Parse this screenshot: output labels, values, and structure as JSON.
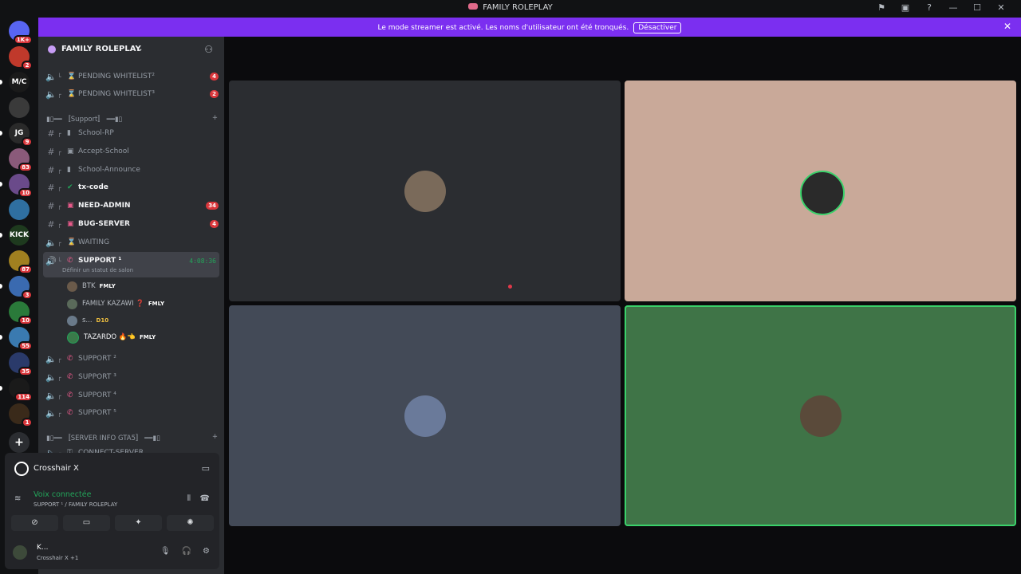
{
  "window": {
    "title": "FAMILY ROLEPLAY"
  },
  "banner": {
    "text": "Le mode streamer est activé. Les noms d'utilisateur ont été tronqués.",
    "button": "Désactiver"
  },
  "rail": [
    {
      "label": "",
      "badge": "1K+",
      "color": "#5865f2"
    },
    {
      "label": "",
      "badge": "2",
      "color": "#c0392b"
    },
    {
      "label": "M/C",
      "badge": "",
      "color": "#1a1a1a"
    },
    {
      "label": "",
      "badge": "",
      "color": "#3a3a3a"
    },
    {
      "label": "JG",
      "badge": "9",
      "color": "#2a2a2a"
    },
    {
      "label": "",
      "badge": "83",
      "color": "#8a5a7a"
    },
    {
      "label": "",
      "badge": "10",
      "color": "#6a4a8a"
    },
    {
      "label": "",
      "badge": "",
      "color": "#2f6fa0"
    },
    {
      "label": "KICK",
      "badge": "",
      "color": "#1e3a1e"
    },
    {
      "label": "",
      "badge": "87",
      "color": "#a08020"
    },
    {
      "label": "",
      "badge": "3",
      "color": "#3a6ab0"
    },
    {
      "label": "",
      "badge": "10",
      "color": "#2a7a3a"
    },
    {
      "label": "",
      "badge": "55",
      "color": "#3a7ab0"
    },
    {
      "label": "",
      "badge": "35",
      "color": "#2a3a6a"
    },
    {
      "label": "",
      "badge": "114",
      "color": "#1a1a1a"
    },
    {
      "label": "",
      "badge": "1",
      "color": "#3a2a1a"
    }
  ],
  "guild": {
    "name": "FAMILY ROLEPLAY"
  },
  "channels": {
    "pending1": {
      "label": "PENDING WHITELIST²",
      "count": "4"
    },
    "pending2": {
      "label": "PENDING WHITELIST³",
      "count": "2"
    },
    "cat_support": "▮▯━━ 〚Support〛 ━━▮▯",
    "school_rp": "School-RP",
    "accept_school": "Accept-School",
    "school_announce": "School-Announce",
    "tx_code": "tx-code",
    "need_admin": {
      "label": "NEED-ADMIN",
      "count": "34"
    },
    "bug_server": {
      "label": "BUG-SERVER",
      "count": "4"
    },
    "waiting": "WAITING",
    "support1": {
      "label": "SUPPORT ¹",
      "timer": "4:08:36",
      "status": "Définir un statut de salon"
    },
    "support2": "SUPPORT ²",
    "support3": "SUPPORT ³",
    "support4": "SUPPORT ⁴",
    "support5": "SUPPORT ⁵",
    "cat_info": "▮▯━━ 〚SERVER INFO GTA5〛 ━━▮▯",
    "connect": "CONNECT-SERVER"
  },
  "voice_users": [
    {
      "name": "BTK",
      "tag": "FMLY"
    },
    {
      "name": "FAMILY KAZAWI ❓",
      "tag": "FMLY"
    },
    {
      "name": "s...",
      "tag": "D10"
    },
    {
      "name": "TAZARDO 🔥👈",
      "tag": "FMLY"
    }
  ],
  "activity": {
    "title": "Crosshair X"
  },
  "voice_panel": {
    "status": "Voix connectée",
    "sub": "SUPPORT ¹ / FAMILY ROLEPLAY"
  },
  "user": {
    "name": "K...",
    "status": "Crosshair X +1"
  },
  "tiles": [
    {
      "bg": "#2b2d31",
      "avatar": "#7a6a5a"
    },
    {
      "bg": "#c9a999",
      "avatar": "#2a2a2a"
    },
    {
      "bg": "#434a57",
      "avatar": "#6a7a9a"
    },
    {
      "bg": "#3f7447",
      "avatar": "#5a4a3a"
    }
  ]
}
